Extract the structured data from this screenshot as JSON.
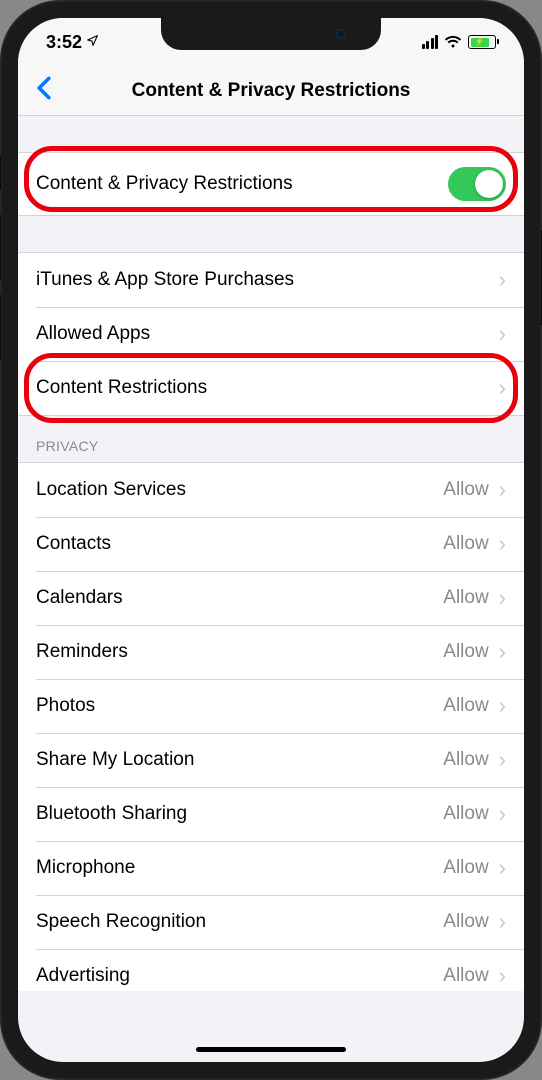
{
  "status": {
    "time": "3:52",
    "locArrow": "➤"
  },
  "nav": {
    "title": "Content & Privacy Restrictions"
  },
  "toggleRow": {
    "label": "Content & Privacy Restrictions",
    "on": true
  },
  "mainRows": [
    {
      "label": "iTunes & App Store Purchases"
    },
    {
      "label": "Allowed Apps"
    },
    {
      "label": "Content Restrictions"
    }
  ],
  "privacy": {
    "header": "PRIVACY",
    "rows": [
      {
        "label": "Location Services",
        "value": "Allow"
      },
      {
        "label": "Contacts",
        "value": "Allow"
      },
      {
        "label": "Calendars",
        "value": "Allow"
      },
      {
        "label": "Reminders",
        "value": "Allow"
      },
      {
        "label": "Photos",
        "value": "Allow"
      },
      {
        "label": "Share My Location",
        "value": "Allow"
      },
      {
        "label": "Bluetooth Sharing",
        "value": "Allow"
      },
      {
        "label": "Microphone",
        "value": "Allow"
      },
      {
        "label": "Speech Recognition",
        "value": "Allow"
      },
      {
        "label": "Advertising",
        "value": "Allow"
      }
    ]
  }
}
